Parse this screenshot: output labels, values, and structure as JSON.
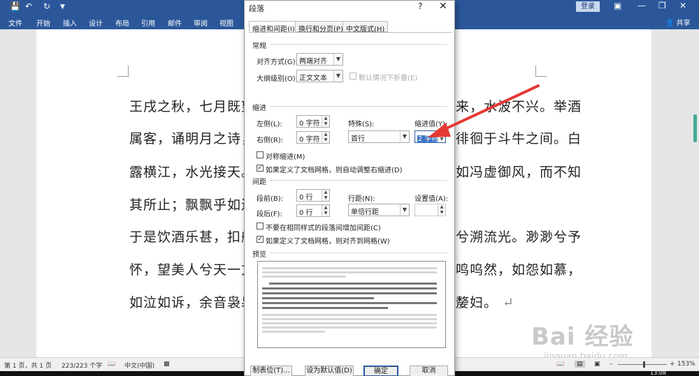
{
  "quick_access": {
    "save_icon": "save-icon",
    "undo_icon": "undo-icon",
    "redo_icon": "redo-icon"
  },
  "ribbon": {
    "tabs": [
      "文件",
      "开始",
      "插入",
      "设计",
      "布局",
      "引用",
      "邮件",
      "审阅",
      "视图"
    ],
    "login_label": "登录",
    "share_label": "共享"
  },
  "document": {
    "lines": [
      "王戌之秋，七月既望，",
      "属客，诵明月之诗，",
      "露横江，水光接天。",
      "其所止；飘飘乎如遗",
      "于是饮酒乐甚，扣舷",
      "怀，望美人兮天一方。",
      "如泣如诉，余音袅袅，"
    ],
    "right_fragments": [
      "来，水波不兴。举酒",
      "徘徊于斗牛之间。白",
      "如冯虚御风，而不知",
      "",
      "兮溯流光。渺渺兮予",
      "鸣呜然，如怨如慕，",
      "嫠妇。"
    ]
  },
  "dialog": {
    "title": "段落",
    "help": "?",
    "close": "✕",
    "tabs": [
      "缩进和间距(I)",
      "换行和分页(P)",
      "中文版式(H)"
    ],
    "general": {
      "heading": "常规",
      "alignment_label": "对齐方式(G):",
      "alignment_value": "两端对齐",
      "outline_label": "大纲级别(O):",
      "outline_value": "正文文本",
      "collapse_label": "默认情况下折叠(E)"
    },
    "indent": {
      "heading": "缩进",
      "left_label": "左侧(L):",
      "left_value": "0 字符",
      "right_label": "右侧(R):",
      "right_value": "0 字符",
      "special_label": "特殊(S):",
      "special_value": "首行",
      "by_label": "缩进值(Y):",
      "by_value": "2 字符",
      "mirror_label": "对称缩进(M)",
      "auto_adjust_label": "如果定义了文档网格，则自动调整右缩进(D)"
    },
    "spacing": {
      "heading": "间距",
      "before_label": "段前(B):",
      "before_value": "0 行",
      "after_label": "段后(F):",
      "after_value": "0 行",
      "line_label": "行距(N):",
      "line_value": "单倍行距",
      "at_label": "设置值(A):",
      "at_value": "",
      "no_space_label": "不要在相同样式的段落间增加间距(C)",
      "snap_grid_label": "如果定义了文档网格，则对齐到网格(W)"
    },
    "preview_heading": "预览",
    "buttons": [
      "制表位(T)...",
      "设为默认值(D)",
      "确定",
      "取消"
    ]
  },
  "status": {
    "page": "第 1 页，共 1 页",
    "words": "223/223 个字",
    "lang": "中文(中国)",
    "zoom": "153%",
    "time": "13:08"
  },
  "watermark": {
    "main": "Bai 经验",
    "sub": "jingyan.baidu.com"
  },
  "colors": {
    "ribbon": "#2b579a",
    "arrow": "#e53935"
  }
}
